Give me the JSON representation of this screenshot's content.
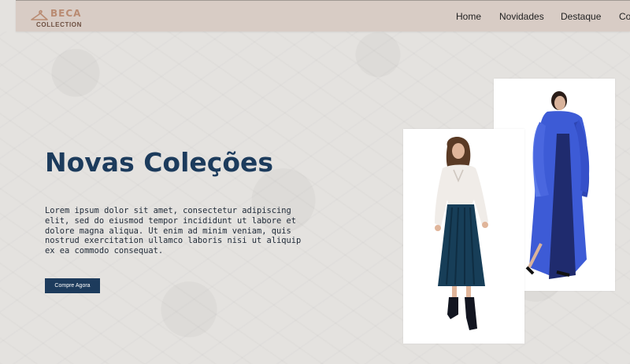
{
  "brand": {
    "name": "BECA",
    "subtitle": "COLLECTION",
    "icon": "hanger-icon",
    "color": "#b98b72"
  },
  "nav": {
    "items": [
      {
        "label": "Home"
      },
      {
        "label": "Novidades"
      },
      {
        "label": "Destaque"
      },
      {
        "label": "Co"
      }
    ]
  },
  "hero": {
    "title": "Novas Coleções",
    "description": "Lorem ipsum dolor sit amet, consectetur adipiscing elit, sed do eiusmod tempor incididunt ut labore et dolore magna aliqua. Ut enim ad minim veniam, quis nostrud exercitation ullamco laboris nisi ut aliquip ex ea commodo consequat.",
    "cta_label": "Compre Agora",
    "accent": "#1d3b5c"
  },
  "images": [
    {
      "subject": "model-in-blue-fur-coat"
    },
    {
      "subject": "model-in-white-blouse-and-pleated-skirt"
    }
  ]
}
